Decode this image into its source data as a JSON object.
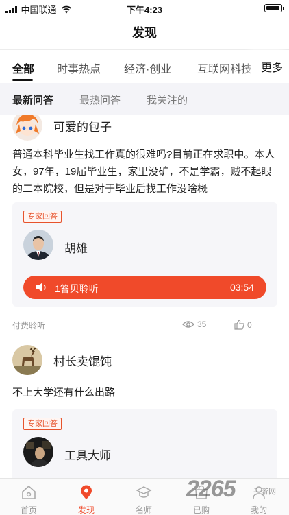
{
  "status_bar": {
    "carrier": "中国联通",
    "time": "下午4:23"
  },
  "header": {
    "title": "发现"
  },
  "category_tabs": [
    {
      "label": "全部",
      "active": true
    },
    {
      "label": "时事热点",
      "active": false
    },
    {
      "label": "经济·创业",
      "active": false
    },
    {
      "label": "互联网科技",
      "active": false
    }
  ],
  "category_more": "更多",
  "sub_tabs": [
    {
      "label": "最新问答",
      "active": true
    },
    {
      "label": "最热问答",
      "active": false
    },
    {
      "label": "我关注的",
      "active": false
    }
  ],
  "posts": [
    {
      "user_name": "可爱的包子",
      "question": "普通本科毕业生找工作真的很难吗?目前正在求职中。本人女，97年，19届毕业生，家里没矿，不是学霸，贼不起眼的二本院校，但是对于毕业后找工作没啥概",
      "expert_badge": "专家回答",
      "expert_name": "胡雄",
      "listen_label": "1答贝聆听",
      "duration": "03:54",
      "paid_label": "付费聆听",
      "views": "35",
      "likes": "0"
    },
    {
      "user_name": "村长卖馄饨",
      "question": "不上大学还有什么出路",
      "expert_badge": "专家回答",
      "expert_name": "工具大师"
    }
  ],
  "tabbar": [
    {
      "label": "首页",
      "icon": "home-icon",
      "active": false
    },
    {
      "label": "发现",
      "icon": "location-pin-icon",
      "active": true
    },
    {
      "label": "名师",
      "icon": "graduation-cap-icon",
      "active": false
    },
    {
      "label": "已购",
      "icon": "shopping-bag-icon",
      "active": false
    },
    {
      "label": "我的",
      "icon": "person-icon",
      "active": false
    }
  ],
  "watermark": {
    "brand": "2265",
    "suffix": "手游网"
  },
  "colors": {
    "accent": "#f04a2a",
    "badge": "#e7532c",
    "card_bg": "#f6f6f9",
    "subtab_bg": "#f4f4f8"
  }
}
